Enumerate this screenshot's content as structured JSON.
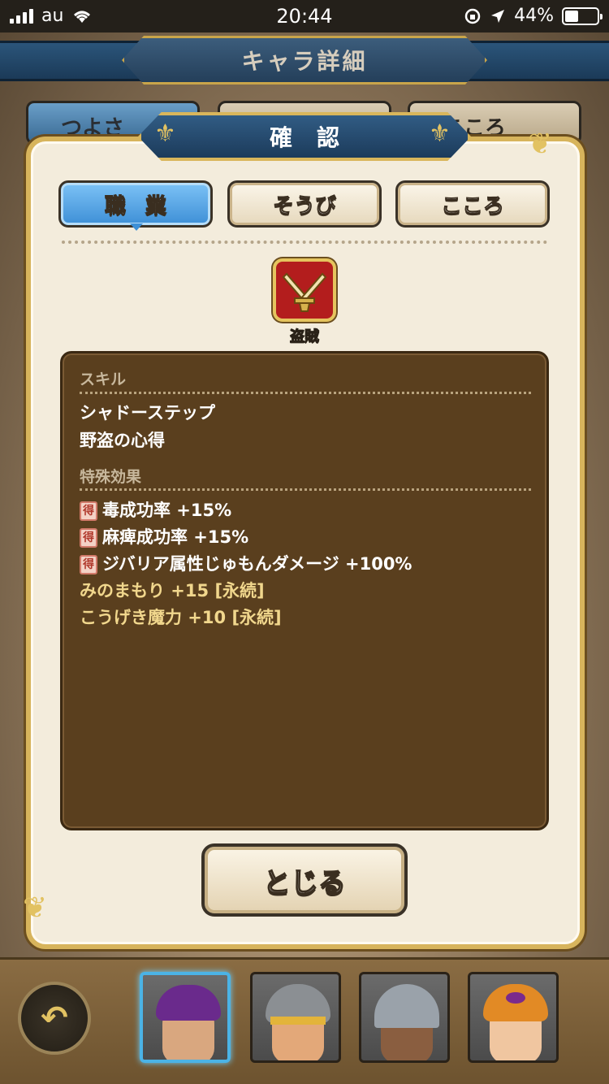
{
  "status_bar": {
    "carrier": "au",
    "time": "20:44",
    "battery": "44%"
  },
  "background": {
    "screen_title": "キャラ詳細",
    "tabs": [
      "つよさ",
      "",
      "こころ"
    ]
  },
  "dialog": {
    "title": "確認",
    "tabs": [
      {
        "label": "職業",
        "active": true
      },
      {
        "label": "そうび",
        "active": false
      },
      {
        "label": "こころ",
        "active": false
      }
    ],
    "job": {
      "icon": "crossed-daggers-icon",
      "name": "盗賊"
    },
    "skill_section": {
      "heading": "スキル",
      "items": [
        "シャドーステップ",
        "野盗の心得"
      ]
    },
    "effects_section": {
      "heading": "特殊効果",
      "badge": "得",
      "badged_items": [
        "毒成功率 +15%",
        "麻痺成功率 +15%",
        "ジバリア属性じゅもんダメージ +100%"
      ],
      "items": [
        "みのまもり +15 [永続]",
        "こうげき魔力 +10 [永続]"
      ]
    },
    "close_label": "とじる"
  },
  "party": {
    "back_icon": "return-arrow-icon",
    "members": [
      "purple-hair-hero",
      "helmet-hero",
      "knight-helmet-hero",
      "orange-hat-hero"
    ]
  },
  "colors": {
    "accent_blue": "#3d8fd6",
    "gold": "#d7b45c",
    "panel_brown": "#5a3f1e",
    "job_red": "#b31d1d"
  }
}
